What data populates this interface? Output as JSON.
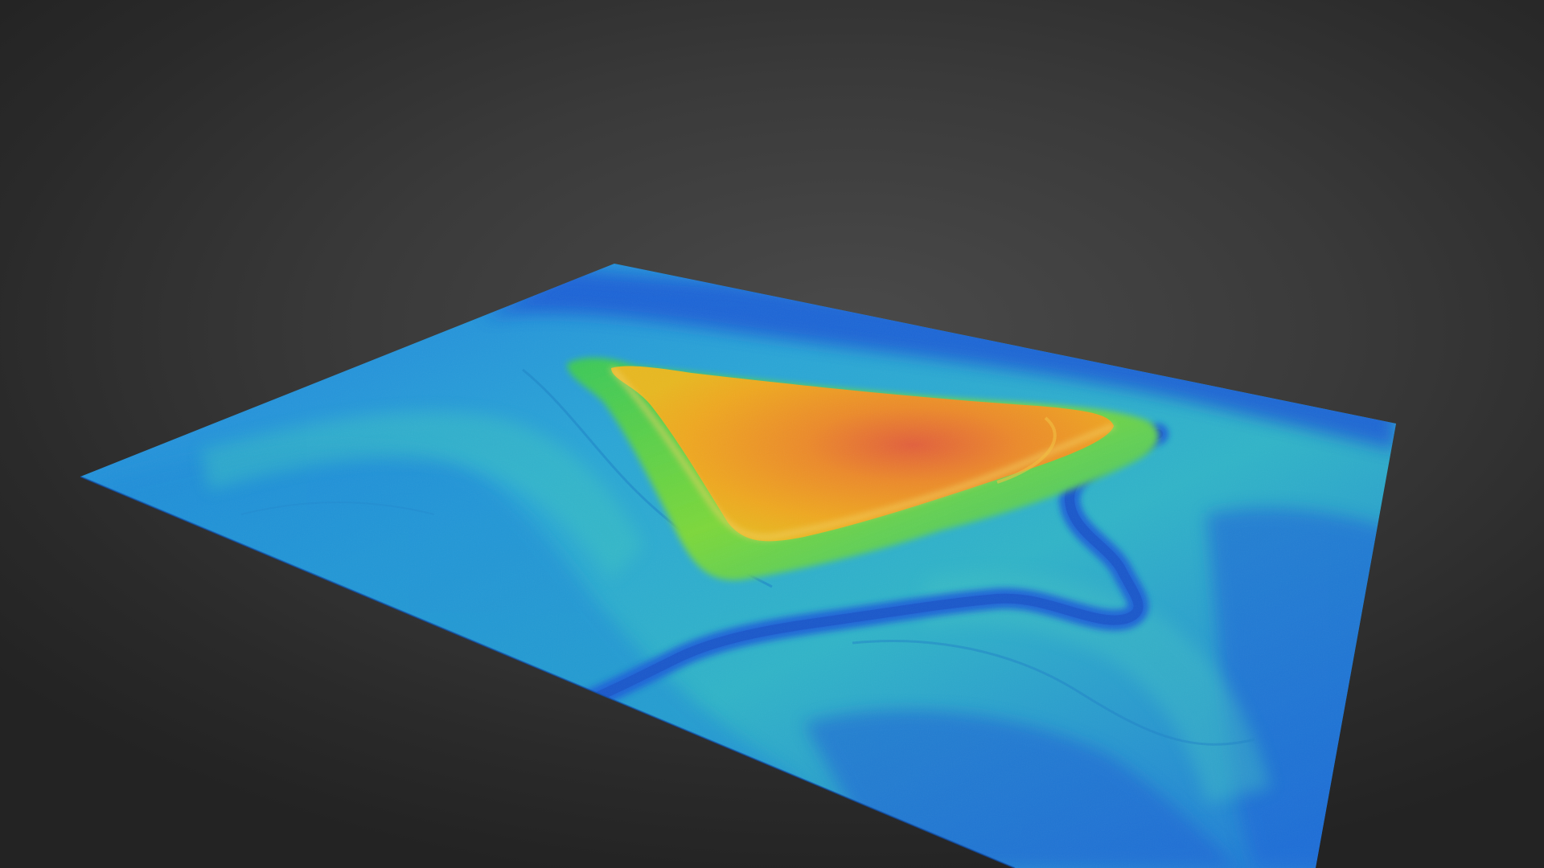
{
  "scene": {
    "background_color": "#2c2c2c",
    "description_colors": {
      "low": "#1f5bd6",
      "mid_low": "#1e8fe0",
      "mid": "#2fb7c8",
      "mid_high": "#4ccf6a",
      "high": "#f0b020",
      "peak": "#e0603a"
    }
  }
}
